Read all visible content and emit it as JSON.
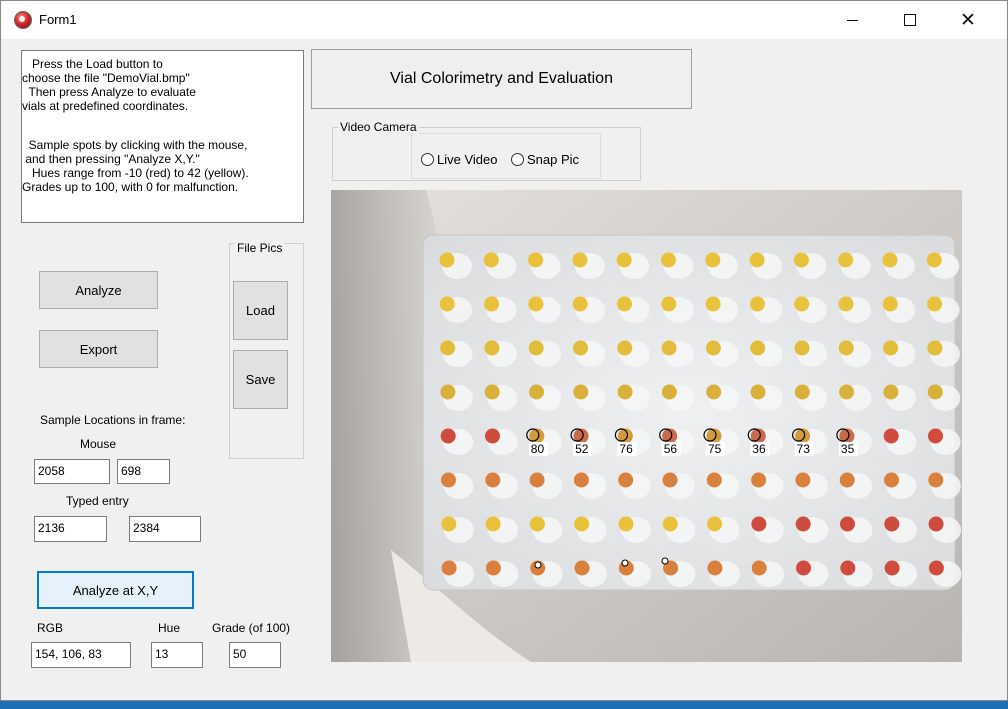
{
  "window": {
    "title": "Form1",
    "controls": {
      "minimize": "minimize",
      "maximize": "maximize",
      "close": "✕"
    }
  },
  "info_text": [
    "   Press the Load button to",
    "choose the file \"DemoVial.bmp\"",
    "  Then press Analyze to evaluate",
    "vials at predefined coordinates.",
    "",
    "  Sample spots by clicking with the mouse,",
    " and then pressing \"Analyze X,Y.\"",
    "   Hues range from -10 (red) to 42 (yellow).",
    "Grades up to 100, with 0 for malfunction."
  ],
  "header_button": "Vial Colorimetry and  Evaluation",
  "video_camera": {
    "legend": "Video Camera",
    "live_label": "Live Video",
    "snap_label": "Snap Pic"
  },
  "file_pics": {
    "legend": "File Pics",
    "load_label": "Load",
    "save_label": "Save"
  },
  "analyze_label": "Analyze",
  "export_label": "Export",
  "sample_locations": {
    "heading": "Sample Locations in frame:",
    "mouse_label": "Mouse",
    "mouse_x": "2058",
    "mouse_y": "698",
    "typed_label": "Typed entry",
    "typed_x": "2136",
    "typed_y": "2384"
  },
  "analyze_xy_label": "Analyze at X,Y",
  "results": {
    "rgb_label": "RGB",
    "rgb_value": "154, 106, 83",
    "hue_label": "Hue",
    "hue_value": "13",
    "grade_label": "Grade (of 100)",
    "grade_value": "50"
  },
  "plate": {
    "grades": [
      "80",
      "52",
      "76",
      "56",
      "75",
      "36",
      "73",
      "35"
    ],
    "row_colors": [
      "#e7c23a",
      "#e7c23a",
      "#e2bd3c",
      "#d9b13a",
      "#cf5a44",
      "#d9ad36",
      "#d9a03c",
      "#cf6b3c"
    ],
    "yellow": "#e8c23a",
    "red": "#cf4b3e",
    "orange": "#d9803c"
  }
}
